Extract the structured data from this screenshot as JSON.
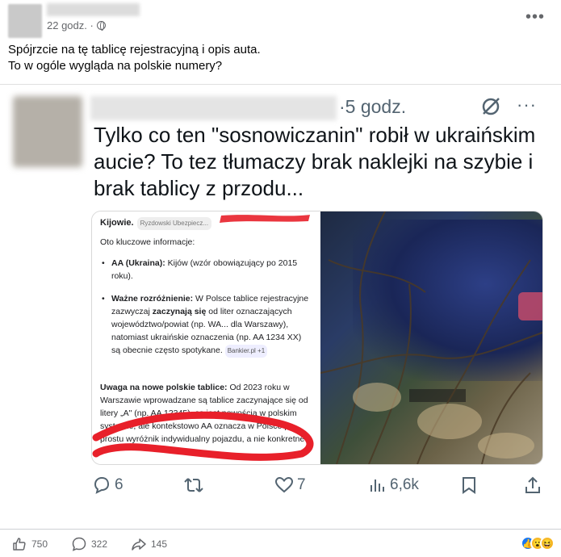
{
  "post": {
    "timestamp": "22 godz. ·",
    "text_line1": "Spójrzcie na tę tablicę rejestracyjną i opis auta.",
    "text_line2": "To w ogóle wygląda na polskie numery?",
    "more_label": "•••"
  },
  "tweet": {
    "time": "·5 godz.",
    "grok_icon": "grok-icon",
    "more_label": "···",
    "text": "Tylko co ten \"sosnowiczanin\" robił w ukraińskim aucie? To tez tłumaczy brak naklejki na szybie i brak tablicy z przodu...",
    "media_left": {
      "heading": "Kijowie.",
      "source_chip": "Ryzdowski Ubezpiecz...",
      "intro": "Oto kluczowe informacje:",
      "bullet1_bold": "AA (Ukraina):",
      "bullet1_text": " Kijów (wzór obowiązujący po 2015 roku).",
      "bullet2_bold": "Ważne rozróżnienie:",
      "bullet2_text1": " W Polsce tablice rejestracyjne zazwyczaj ",
      "bullet2_bold2": "zaczynają się",
      "bullet2_text2": " od liter oznaczających województwo/powiat (np. WA... dla Warszawy), natomiast ukraińskie oznaczenia (np. AA 1234 XX) są obecnie często spotykane.",
      "bullet2_chip": "Bankier.pl +1",
      "warn_bold": "Uwaga na nowe polskie tablice:",
      "warn_text": " Od 2023 roku w Warszawie wprowadzane są tablice zaczynające się od litery „A\" (np. AA 12345), co jest nowością w polskim systemie, ale kontekstowo AA oznacza w Polsce po prostu wyróżnik indywidualny pojazdu, a nie konkretne"
    },
    "actions": {
      "replies": "6",
      "likes": "7",
      "views": "6,6k"
    }
  },
  "footer": {
    "likes": "750",
    "comments": "322",
    "shares": "145"
  },
  "colors": {
    "accent_red": "#e8202a",
    "twitter_gray": "#536471",
    "fb_gray": "#65676b",
    "fb_blue": "#1877f2"
  }
}
